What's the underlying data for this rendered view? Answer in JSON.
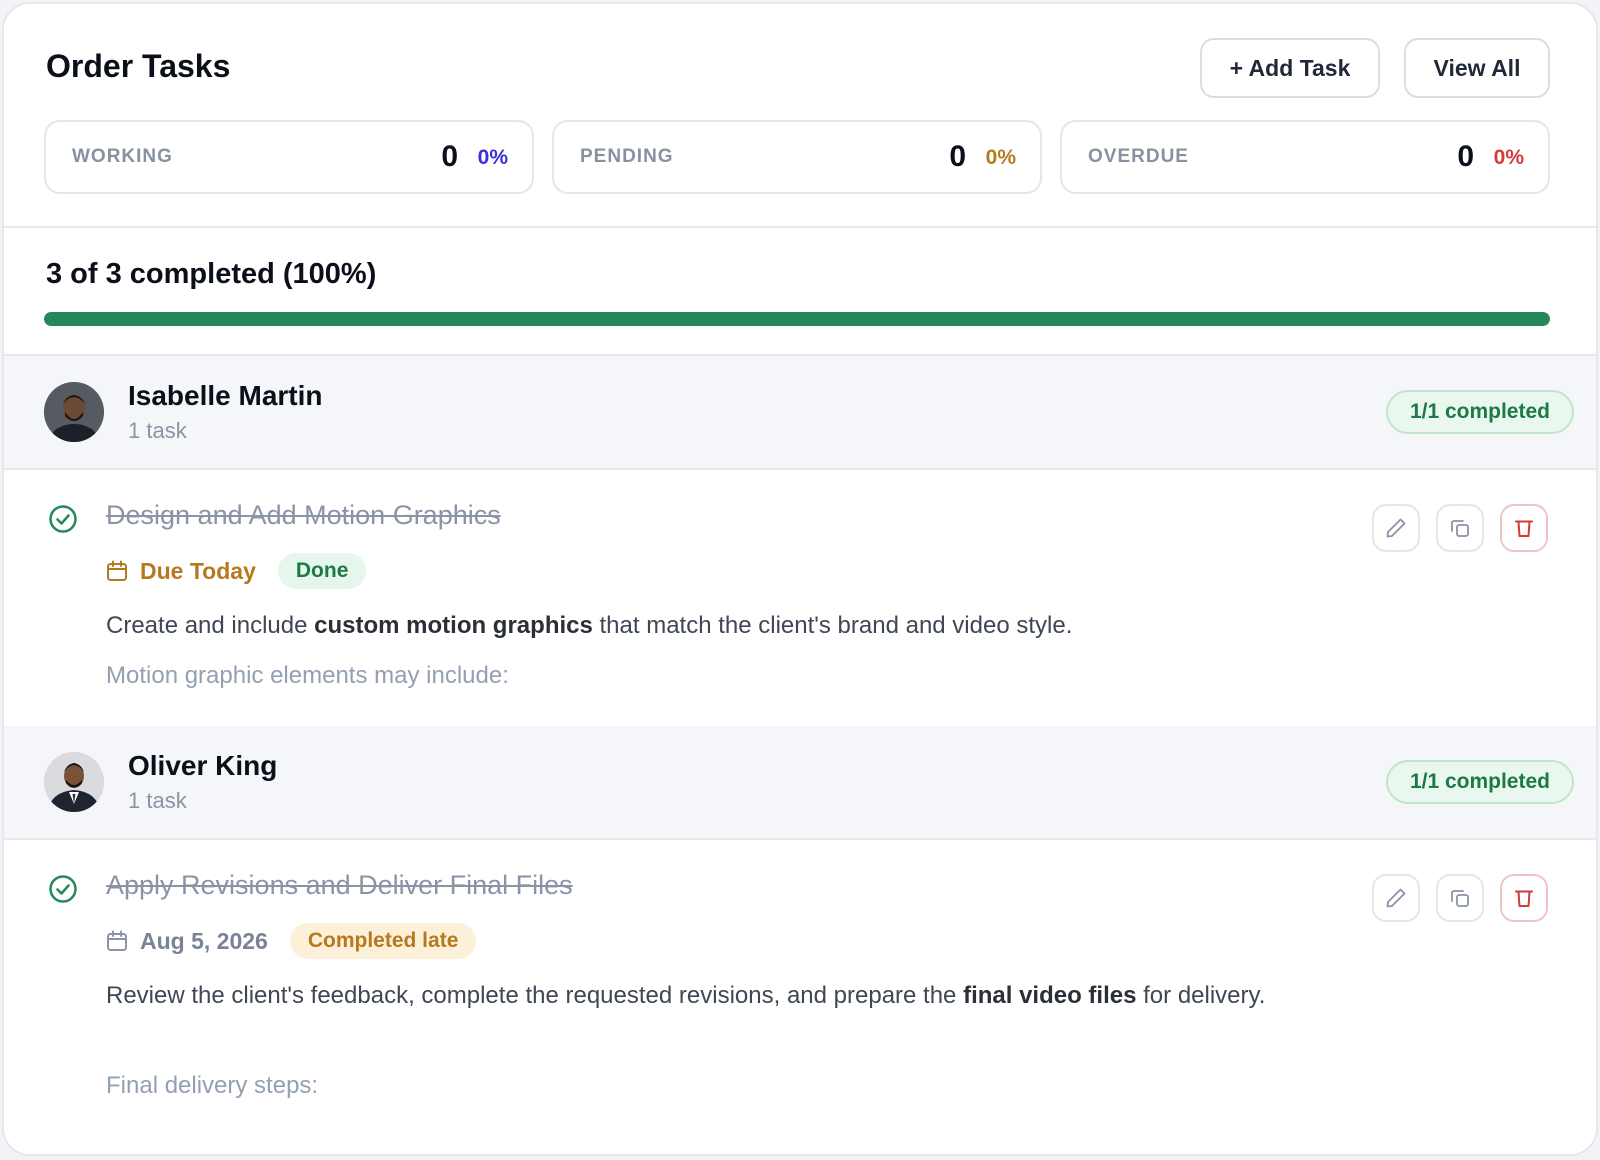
{
  "header": {
    "title": "Order Tasks",
    "add_label": "+ Add Task",
    "view_label": "View All"
  },
  "stats": [
    {
      "label": "WORKING",
      "count": "0",
      "percent": "0%",
      "color": "#3b2fd6"
    },
    {
      "label": "PENDING",
      "count": "0",
      "percent": "0%",
      "color": "#b7791f"
    },
    {
      "label": "OVERDUE",
      "count": "0",
      "percent": "0%",
      "color": "#d33a3a"
    }
  ],
  "progress": {
    "text": "3 of 3 completed (100%)",
    "fraction": 1.0,
    "color": "#24895a"
  },
  "groups": [
    {
      "name": "Isabelle Martin",
      "task_count": "1 task",
      "badge": "1/1 completed",
      "tasks": [
        {
          "title": "Design and Add Motion Graphics",
          "due": "Due Today",
          "due_color": "#b7791f",
          "status": "Done",
          "status_bg": "#e6f6ec",
          "status_color": "#1c7a45",
          "desc_before": "Create and include ",
          "desc_bold": "custom motion graphics",
          "desc_after": " that match the client's brand and video style.",
          "sub": "Motion graphic elements may include:"
        }
      ]
    },
    {
      "name": "Oliver King",
      "task_count": "1 task",
      "badge": "1/1 completed",
      "tasks": [
        {
          "title": "Apply Revisions and Deliver Final Files",
          "due": "Aug 5, 2026",
          "due_color": "#7a8394",
          "status": "Completed late",
          "status_bg": "#fdf0d8",
          "status_color": "#b7791f",
          "desc_before": "Review the client's feedback, complete the requested revisions, and prepare the ",
          "desc_bold": "final video files",
          "desc_after": " for delivery.",
          "sub": "Final delivery steps:"
        }
      ]
    }
  ],
  "icons": {
    "check": "check-circle-icon",
    "calendar": "calendar-icon",
    "edit": "pencil-icon",
    "duplicate": "copy-icon",
    "delete": "trash-icon"
  }
}
